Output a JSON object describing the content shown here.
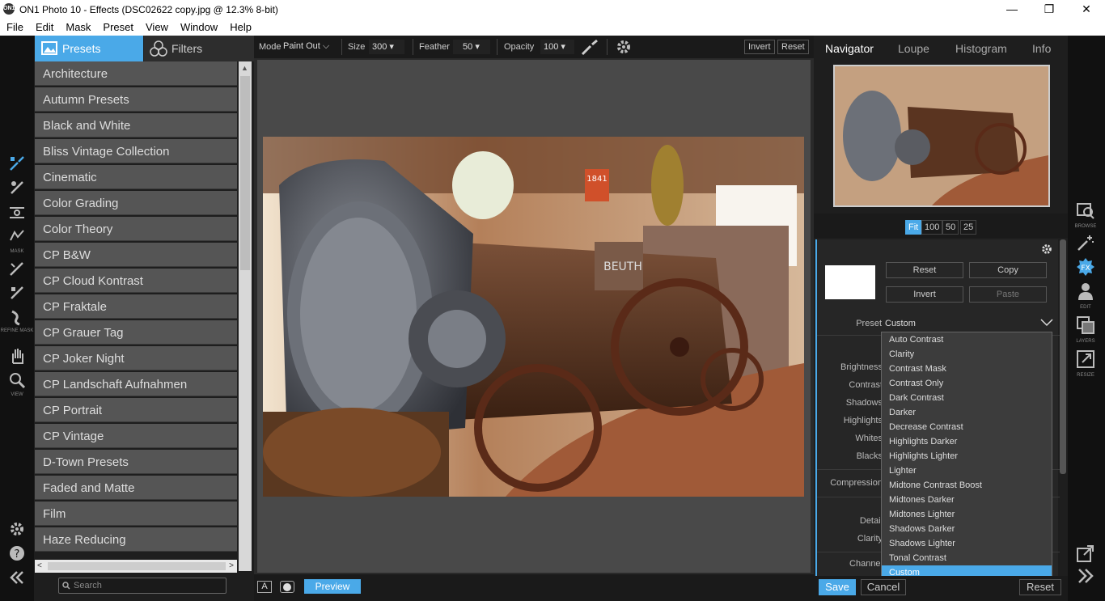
{
  "window": {
    "title": "ON1 Photo 10 - Effects (DSC02622 copy.jpg @ 12.3% 8-bit)",
    "app_icon_text": "ON1",
    "minimize": "—",
    "maximize": "❐",
    "close": "✕"
  },
  "menu": [
    "File",
    "Edit",
    "Mask",
    "Preset",
    "View",
    "Window",
    "Help"
  ],
  "left_tools": {
    "mask_caption": "MASK",
    "refine_caption": "REFINE MASK",
    "view_caption": "VIEW"
  },
  "left_panel": {
    "tab_presets": "Presets",
    "tab_filters": "Filters",
    "presets": [
      "Architecture",
      "Autumn Presets",
      "Black and White",
      "Bliss Vintage Collection",
      "Cinematic",
      "Color Grading",
      "Color Theory",
      "CP B&W",
      "CP Cloud Kontrast",
      "CP Fraktale",
      "CP Grauer Tag",
      "CP Joker Night",
      "CP Landschaft Aufnahmen",
      "CP Portrait",
      "CP Vintage",
      "D-Town Presets",
      "Faded and Matte",
      "Film",
      "Haze Reducing"
    ],
    "search_placeholder": "Search"
  },
  "toolbar": {
    "mode_label": "Mode",
    "mode_value": "Paint Out",
    "size_label": "Size",
    "size_value": "300",
    "feather_label": "Feather",
    "feather_value": "50",
    "opacity_label": "Opacity",
    "opacity_value": "100",
    "invert": "Invert",
    "reset": "Reset"
  },
  "photo": {
    "sign_text": "1841",
    "nameplate": "BEUTH"
  },
  "bottom": {
    "preview": "Preview",
    "a_label": "A"
  },
  "right_panel": {
    "tabs": [
      "Navigator",
      "Loupe",
      "Histogram",
      "Info"
    ],
    "zoom": [
      "Fit",
      "100",
      "50",
      "25"
    ],
    "buttons": {
      "reset": "Reset",
      "copy": "Copy",
      "invert": "Invert",
      "paste": "Paste"
    },
    "preset_label": "Preset",
    "preset_value": "Custom",
    "sliders": [
      "Brightness",
      "Contrast",
      "Shadows",
      "Highlights",
      "Whites",
      "Blacks"
    ],
    "compression": "Compression",
    "detail": "Detail",
    "clarity": "Clarity",
    "channel": "Channel",
    "save": "Save",
    "cancel": "Cancel",
    "reset": "Reset"
  },
  "dropdown": {
    "options": [
      "Auto Contrast",
      "Clarity",
      "Contrast Mask",
      "Contrast Only",
      "Dark Contrast",
      "Darker",
      "Decrease Contrast",
      "Highlights Darker",
      "Highlights Lighter",
      "Lighter",
      "Midtone Contrast Boost",
      "Midtones Darker",
      "Midtones Lighter",
      "Shadows Darker",
      "Shadows Lighter",
      "Tonal Contrast",
      "Custom"
    ],
    "selected": "Custom"
  },
  "right_rail": {
    "browse": "BROWSE",
    "fx": "FX",
    "edit": "EDIT",
    "layers": "LAYERS",
    "resize": "RESIZE"
  },
  "colors": {
    "accent": "#4aa9e8",
    "panel": "#1e1e1e",
    "item": "#555555"
  }
}
